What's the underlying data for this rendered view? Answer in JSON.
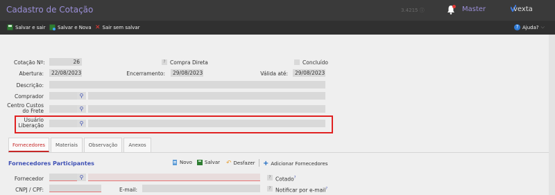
{
  "header": {
    "title": "Cadastro de Cotação",
    "version": "3.4215 ⓘ",
    "user": "Master",
    "brand": "vexta"
  },
  "toolbar": {
    "save_exit": "Salvar e sair",
    "save_new": "Salvar e Nova",
    "exit_nosave": "Sair sem salvar",
    "help": "Ajuda?"
  },
  "form": {
    "cotacao_label": "Cotação Nº:",
    "cotacao_value": "26",
    "compra_direta_label": "Compra Direta",
    "concluido_label": "Concluído",
    "abertura_label": "Abertura:",
    "abertura_value": "22/08/2023",
    "encerramento_label": "Encerramento:",
    "encerramento_value": "29/08/2023",
    "valida_label": "Válida até:",
    "valida_value": "29/08/2023",
    "descricao_label": "Descrição:",
    "comprador_label": "Comprador",
    "centro_label_1": "Centro Custos",
    "centro_label_2": "do Frete",
    "usuario_label_1": "Usuário",
    "usuario_label_2": "Liberação"
  },
  "tabs": [
    "Fornecedores",
    "Materiais",
    "Observação",
    "Anexos"
  ],
  "section": {
    "title": "Fornecedores Participantes",
    "actions": {
      "novo": "Novo",
      "salvar": "Salvar",
      "desfazer": "Desfazer",
      "adicionar": "Adicionar Fornecedores"
    },
    "fornecedor_label": "Fornecedor",
    "cotado_label": "Cotado",
    "cnpj_label": "CNPJ / CPF:",
    "email_label": "E-mail:",
    "notificar_label": "Notificar por e-mail"
  },
  "colors": {
    "accent": "#9b8fd8",
    "header_bg": "#3a3a3a",
    "toolbar_bg": "#303030",
    "tab_active": "#c62828",
    "section_title": "#3f51b5",
    "highlight": "#e02020"
  }
}
